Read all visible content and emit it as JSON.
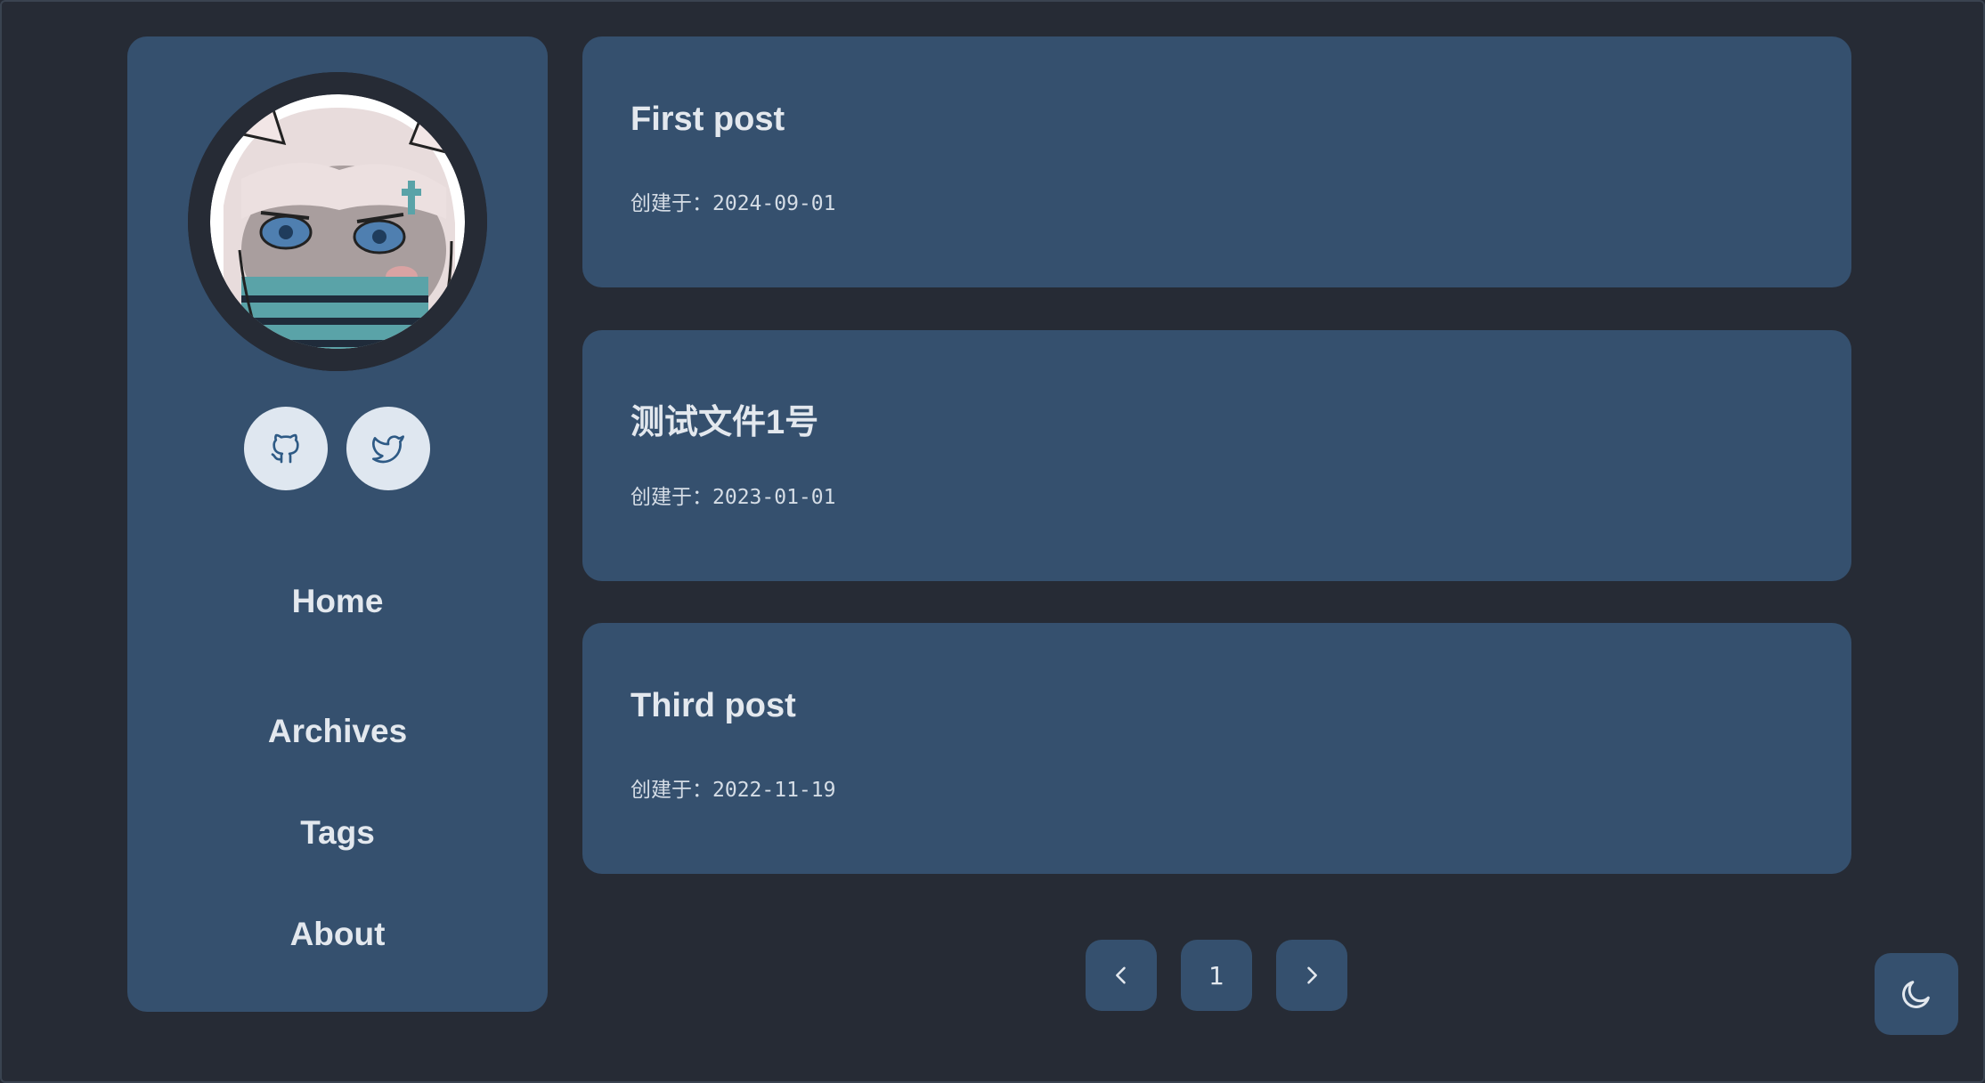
{
  "sidebar": {
    "nav": [
      {
        "label": "Home"
      },
      {
        "label": "Archives"
      },
      {
        "label": "Tags"
      },
      {
        "label": "About"
      }
    ],
    "social": [
      {
        "icon": "github-icon"
      },
      {
        "icon": "twitter-icon"
      }
    ]
  },
  "posts": [
    {
      "title": "First post",
      "meta": "创建于：2024-09-01"
    },
    {
      "title": "测试文件1号",
      "meta": "创建于：2023-01-01"
    },
    {
      "title": "Third post",
      "meta": "创建于：2022-11-19"
    }
  ],
  "pagination": {
    "prev_icon": "chevron-left-icon",
    "current": "1",
    "next_icon": "chevron-right-icon"
  },
  "theme_toggle": {
    "icon": "moon-icon"
  },
  "colors": {
    "background": "#262b35",
    "card": "#35506e",
    "text": "#e3e8ee",
    "social_bg": "#dfe7f0",
    "icon_accent": "#2e5a85"
  }
}
